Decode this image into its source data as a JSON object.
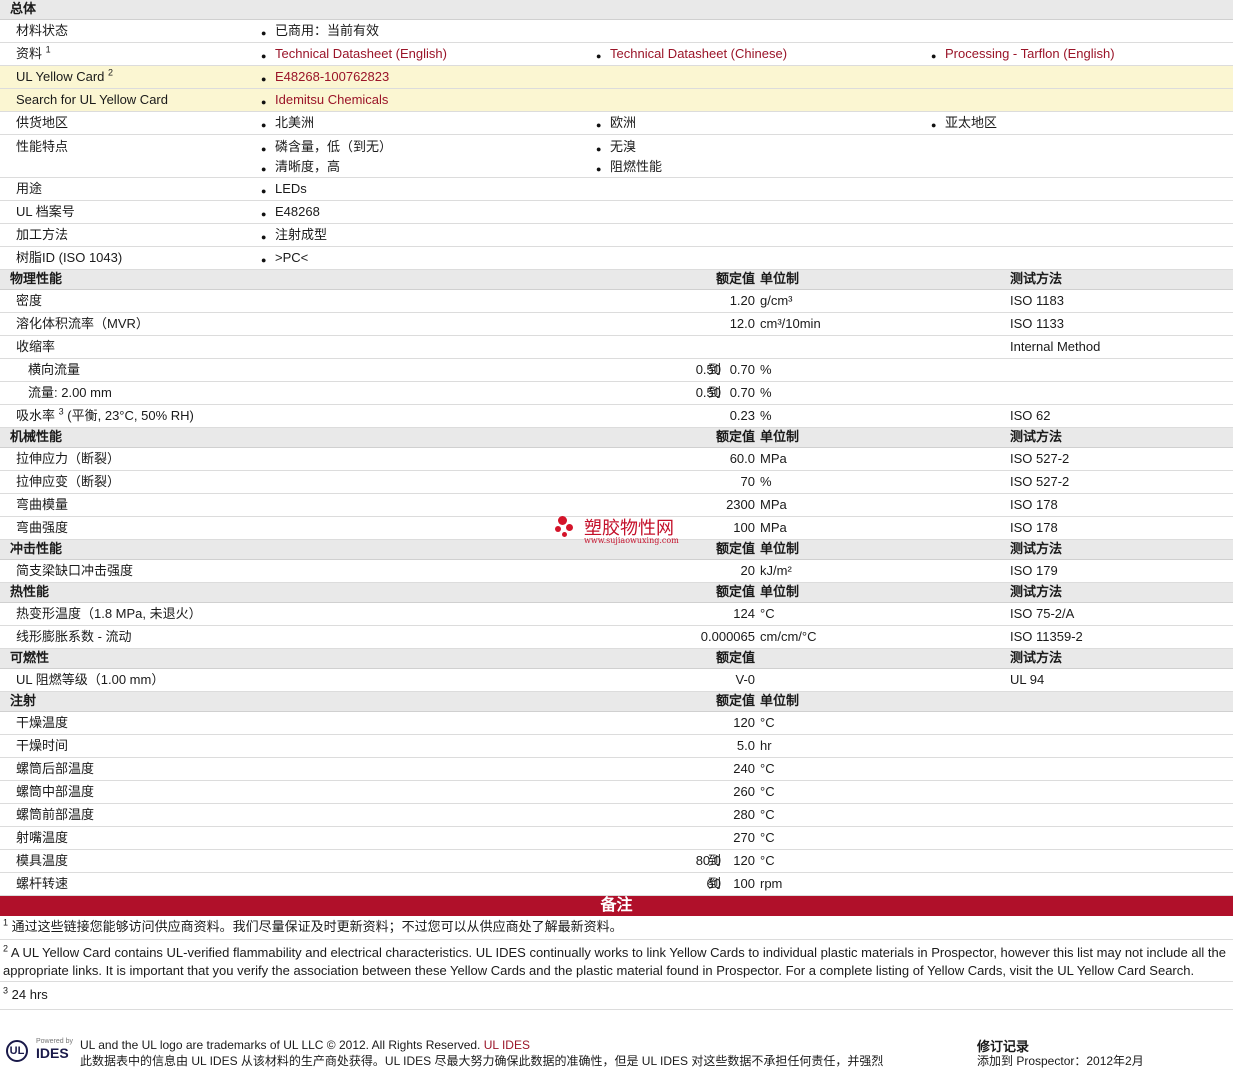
{
  "general": {
    "section": "总体",
    "material_status": {
      "label": "材料状态",
      "value": "已商用：当前有效"
    },
    "resources": {
      "label": "资料",
      "sup": "1",
      "links": [
        "Technical Datasheet (English)",
        "Technical Datasheet (Chinese)",
        "Processing - Tarflon (English)"
      ]
    },
    "ul_card": {
      "label": "UL Yellow Card",
      "sup": "2",
      "value": "E48268-100762823"
    },
    "ul_search": {
      "label": "Search for UL Yellow Card",
      "value": "Idemitsu Chemicals"
    },
    "regions": {
      "label": "供货地区",
      "values": [
        "北美洲",
        "欧洲",
        "亚太地区"
      ]
    },
    "features": {
      "label": "性能特点",
      "values": [
        "磷含量，低（到无）",
        "无溴",
        "清晰度，高",
        "阻燃性能"
      ]
    },
    "uses": {
      "label": "用途",
      "value": "LEDs"
    },
    "ul_file": {
      "label": "UL 档案号",
      "value": "E48268"
    },
    "processing": {
      "label": "加工方法",
      "value": "注射成型"
    },
    "resin_id": {
      "label": "树脂ID (ISO 1043)",
      "value": ">PC<"
    }
  },
  "headers": {
    "value": "额定值",
    "unit": "单位制",
    "method": "测试方法"
  },
  "physical": {
    "section": "物理性能",
    "rows": [
      {
        "label": "密度",
        "value": "1.20",
        "unit": "g/cm³",
        "method": "ISO 1183"
      },
      {
        "label": "溶化体积流率（MVR）",
        "value": "12.0",
        "unit": "cm³/10min",
        "method": "ISO 1133"
      },
      {
        "label": "收缩率",
        "value": "",
        "unit": "",
        "method": "Internal Method"
      }
    ],
    "shrink_rows": [
      {
        "label": "横向流量",
        "from": "0.50",
        "to_word": "到",
        "to": "0.70",
        "unit": "%"
      },
      {
        "label": "流量: 2.00 mm",
        "from": "0.50",
        "to_word": "到",
        "to": "0.70",
        "unit": "%"
      }
    ],
    "water": {
      "label": "吸水率",
      "sup": "3",
      "cond": "(平衡, 23°C, 50% RH)",
      "value": "0.23",
      "unit": "%",
      "method": "ISO 62"
    }
  },
  "mechanical": {
    "section": "机械性能",
    "rows": [
      {
        "label": "拉伸应力（断裂）",
        "value": "60.0",
        "unit": "MPa",
        "method": "ISO 527-2"
      },
      {
        "label": "拉伸应变（断裂）",
        "value": "70",
        "unit": "%",
        "method": "ISO 527-2"
      },
      {
        "label": "弯曲模量",
        "value": "2300",
        "unit": "MPa",
        "method": "ISO 178"
      },
      {
        "label": "弯曲强度",
        "value": "100",
        "unit": "MPa",
        "method": "ISO 178"
      }
    ]
  },
  "impact": {
    "section": "冲击性能",
    "rows": [
      {
        "label": "简支梁缺口冲击强度",
        "value": "20",
        "unit": "kJ/m²",
        "method": "ISO 179"
      }
    ]
  },
  "thermal": {
    "section": "热性能",
    "rows": [
      {
        "label": "热变形温度（1.8 MPa, 未退火）",
        "value": "124",
        "unit": "°C",
        "method": "ISO 75-2/A"
      },
      {
        "label": "线形膨胀系数 - 流动",
        "value": "0.000065",
        "unit": "cm/cm/°C",
        "method": "ISO 11359-2"
      }
    ]
  },
  "flammability": {
    "section": "可燃性",
    "rows": [
      {
        "label": "UL 阻燃等级（1.00 mm）",
        "value": "V-0",
        "unit": "",
        "method": "UL 94"
      }
    ]
  },
  "injection": {
    "section": "注射",
    "rows": [
      {
        "label": "干燥温度",
        "value": "120",
        "unit": "°C"
      },
      {
        "label": "干燥时间",
        "value": "5.0",
        "unit": "hr"
      },
      {
        "label": "螺筒后部温度",
        "value": "240",
        "unit": "°C"
      },
      {
        "label": "螺筒中部温度",
        "value": "260",
        "unit": "°C"
      },
      {
        "label": "螺筒前部温度",
        "value": "280",
        "unit": "°C"
      },
      {
        "label": "射嘴温度",
        "value": "270",
        "unit": "°C"
      }
    ],
    "range_rows": [
      {
        "label": "模具温度",
        "from": "80.0",
        "to_word": "到",
        "to": "120",
        "unit": "°C"
      },
      {
        "label": "螺杆转速",
        "from": "60",
        "to_word": "到",
        "to": "100",
        "unit": "rpm"
      }
    ]
  },
  "notes": {
    "title": "备注",
    "items": [
      {
        "num": "1",
        "text": "通过这些链接您能够访问供应商资料。我们尽量保证及时更新资料；不过您可以从供应商处了解最新资料。"
      },
      {
        "num": "2",
        "text": "A UL Yellow Card contains UL-verified flammability and electrical characteristics. UL IDES continually works to link Yellow Cards to individual plastic materials in Prospector, however this list may not include all the appropriate links. It is important that you verify the association between these Yellow Cards and the plastic material found in Prospector. For a complete listing of Yellow Cards, visit the UL Yellow Card Search."
      },
      {
        "num": "3",
        "text": "24 hrs"
      }
    ]
  },
  "watermark": {
    "name": "塑胶物性网",
    "url": "www.sujiaowuxing.com"
  },
  "footer": {
    "logo_text": "UL",
    "powered": "Powered by",
    "ides": "IDES",
    "trademark": "UL and the UL logo are trademarks of UL LLC © 2012. All Rights Reserved.",
    "trademark_link": "UL IDES",
    "disclaimer": "此数据表中的信息由 UL IDES 从该材料的生产商处获得。UL IDES 尽最大努力确保此数据的准确性，但是 UL IDES 对这些数据不承担任何责任，并强烈",
    "rev_title": "修订记录",
    "rev_text": "添加到 Prospector：2012年2月"
  }
}
